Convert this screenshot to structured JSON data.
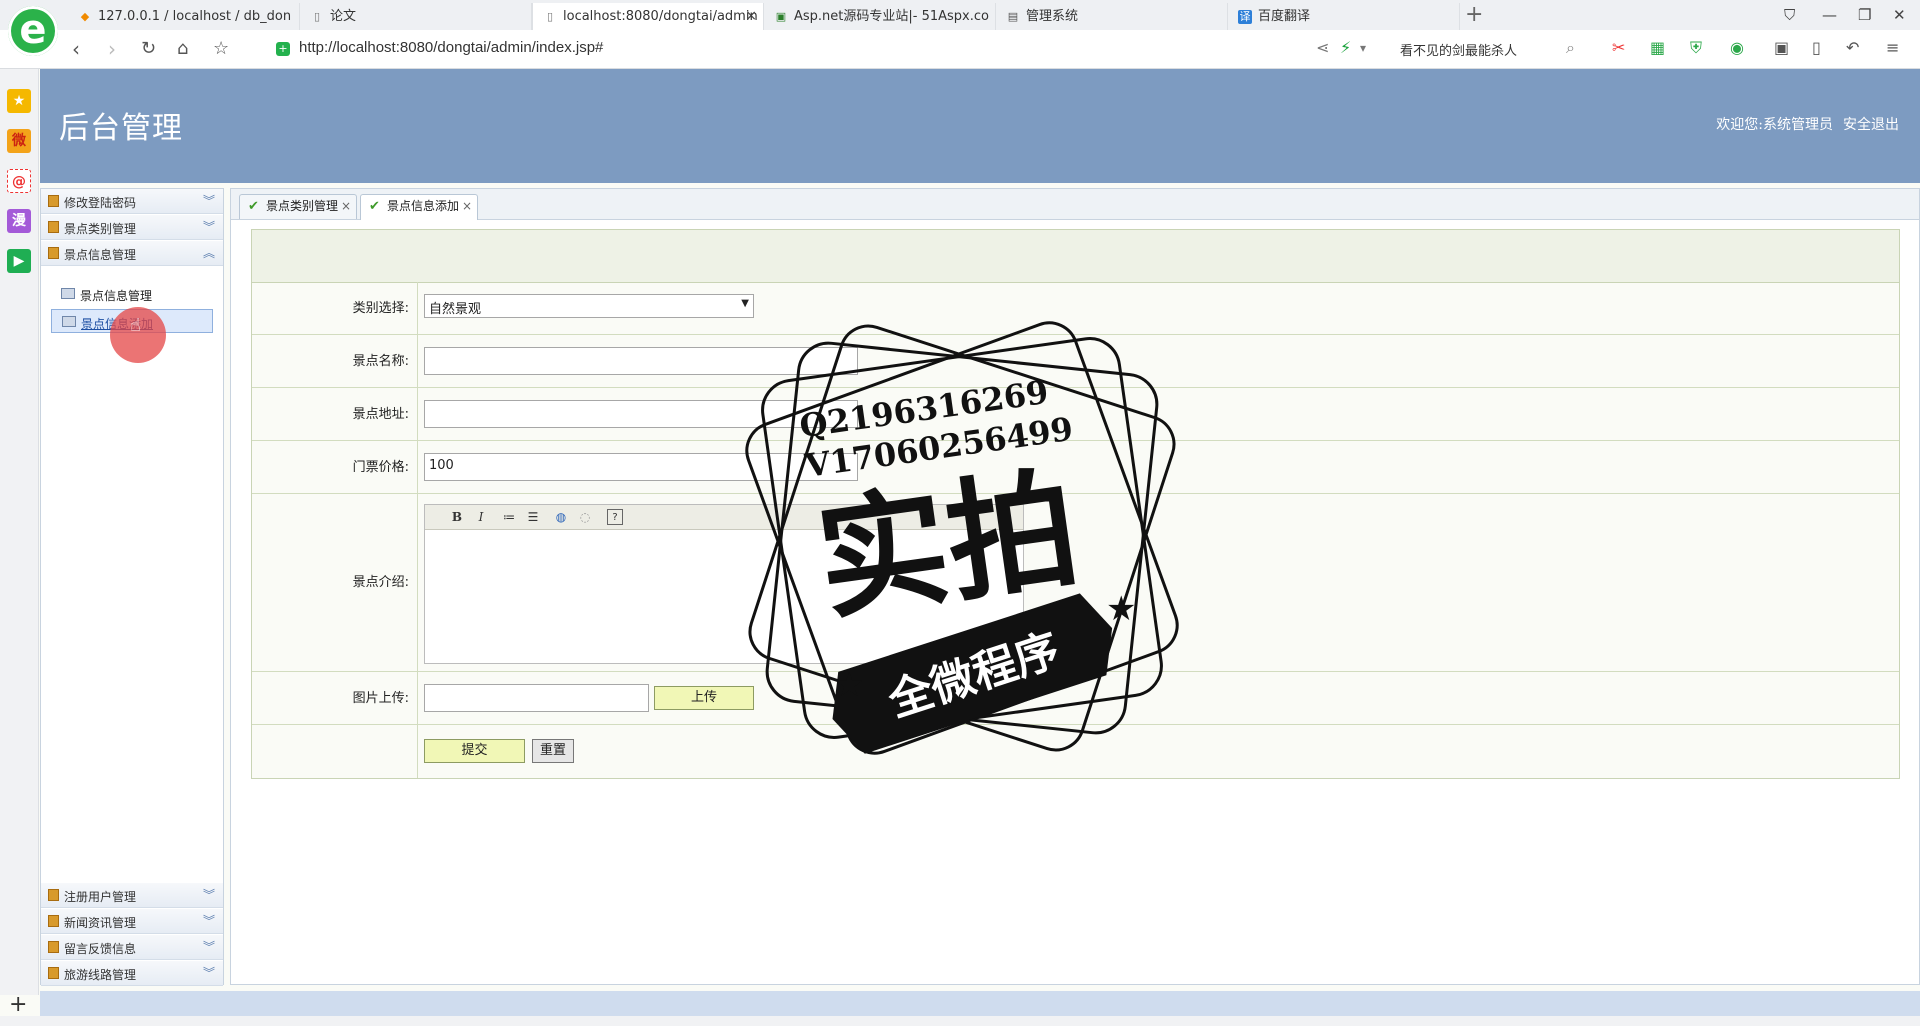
{
  "browser": {
    "tabs": [
      {
        "label": "127.0.0.1 / localhost / db_don"
      },
      {
        "label": "论文"
      },
      {
        "label": "localhost:8080/dongtai/admin"
      },
      {
        "label": "Asp.net源码专业站|- 51Aspx.co"
      },
      {
        "label": "管理系统"
      },
      {
        "label": "百度翻译"
      }
    ],
    "url": "http://localhost:8080/dongtai/admin/index.jsp#",
    "search_text": "看不见的剑最能杀人",
    "new_tab": "+",
    "close_x": "×"
  },
  "quickbar": {
    "weibo": "微",
    "at": "@",
    "manga": "漫",
    "add": "+"
  },
  "header": {
    "title": "后台管理",
    "welcome": "欢迎您:系统管理员",
    "logout": "安全退出"
  },
  "menu": {
    "sections": [
      {
        "label": "修改登陆密码",
        "arrow": "︾"
      },
      {
        "label": "景点类别管理",
        "arrow": "︾"
      },
      {
        "label": "景点信息管理",
        "arrow": "︽"
      }
    ],
    "sub_items": [
      {
        "label": "景点信息管理"
      },
      {
        "label": "景点信息添加"
      }
    ],
    "bottom_sections": [
      {
        "label": "注册用户管理",
        "arrow": "︾"
      },
      {
        "label": "新闻资讯管理",
        "arrow": "︾"
      },
      {
        "label": "留言反馈信息",
        "arrow": "︾"
      },
      {
        "label": "旅游线路管理",
        "arrow": "︾"
      }
    ]
  },
  "content_tabs": [
    {
      "label": "景点类别管理"
    },
    {
      "label": "景点信息添加"
    }
  ],
  "form": {
    "category_label": "类别选择:",
    "category_value": "自然景观",
    "name_label": "景点名称:",
    "name_value": "",
    "address_label": "景点地址:",
    "address_value": "",
    "price_label": "门票价格:",
    "price_value": "100",
    "intro_label": "景点介绍:",
    "image_label": "图片上传:",
    "upload_button": "上传",
    "submit_button": "提交",
    "reset_button": "重置"
  },
  "editor_toolbar": {
    "bold": "B",
    "italic": "I",
    "help": "?"
  },
  "watermark": {
    "qq": "Q2196316269",
    "wechat": "V17060256499",
    "main": "实拍",
    "banner": "全微程序"
  },
  "colors": {
    "header_bg": "#7d9bc1",
    "status_bg": "#cfdcee",
    "button_yellow": "#f1f7b6"
  }
}
